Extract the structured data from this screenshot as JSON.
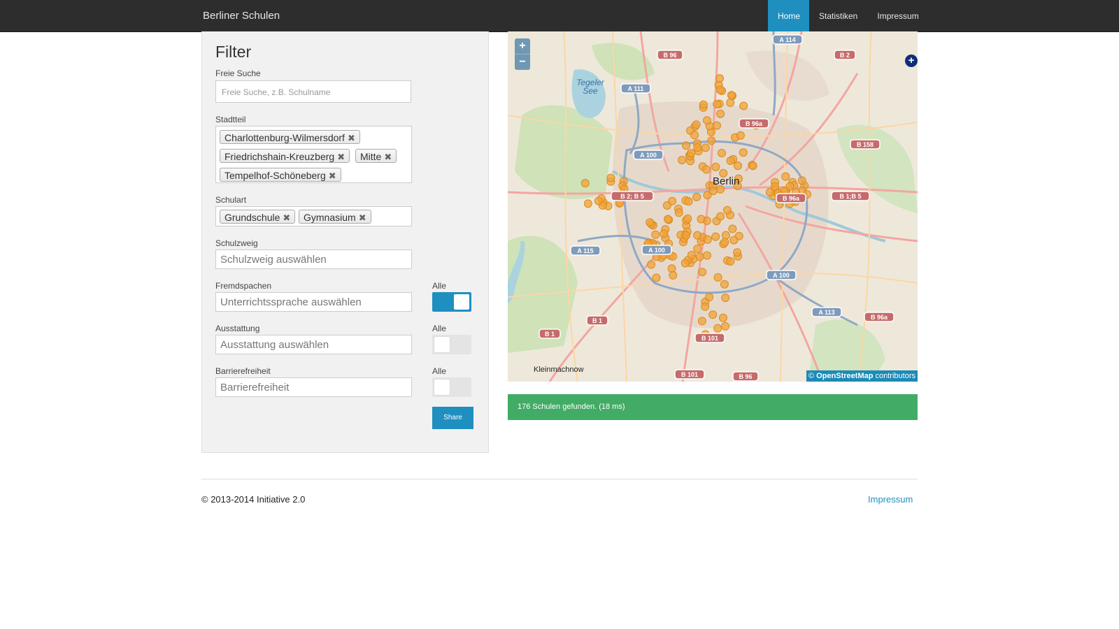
{
  "navbar": {
    "brand": "Berliner Schulen",
    "items": [
      {
        "label": "Home",
        "active": true
      },
      {
        "label": "Statistiken",
        "active": false
      },
      {
        "label": "Impressum",
        "active": false
      }
    ]
  },
  "filter": {
    "title": "Filter",
    "search": {
      "label": "Freie Suche",
      "placeholder": "Freie Suche, z.B. Schulname"
    },
    "district": {
      "label": "Stadtteil",
      "tags": [
        "Charlottenburg-Wilmersdorf",
        "Friedrichshain-Kreuzberg",
        "Mitte",
        "Tempelhof-Schöneberg"
      ]
    },
    "school_type": {
      "label": "Schulart",
      "tags": [
        "Grundschule",
        "Gymnasium"
      ]
    },
    "branch": {
      "label": "Schulzweig",
      "placeholder": "Schulzweig auswählen"
    },
    "languages": {
      "label": "Fremdspachen",
      "placeholder": "Unterrichtssprache auswählen",
      "toggle_label": "Alle",
      "toggle_on": true
    },
    "equipment": {
      "label": "Ausstattung",
      "placeholder": "Ausstattung auswählen",
      "toggle_label": "Alle",
      "toggle_on": false
    },
    "accessibility": {
      "label": "Barrierefreiheit",
      "placeholder": "Barrierefreiheit",
      "toggle_label": "Alle",
      "toggle_on": false
    },
    "share_label": "Share"
  },
  "map": {
    "zoom_in": "+",
    "zoom_out": "−",
    "city_label": "Berlin",
    "place_label": "Kleinmachnow",
    "lake_label": "Tegeler See",
    "attribution_prefix": "©",
    "attribution_link": "OpenStreetMap",
    "attribution_suffix": "contributors",
    "road_shields": [
      "A 114",
      "B 96",
      "B 2",
      "A 111",
      "B 96a",
      "B 158",
      "A 100",
      "B 2; B 5",
      "B 1;B 5",
      "B 96a",
      "A 115",
      "A 100",
      "A 100",
      "A 113",
      "B 96a",
      "B 1",
      "B 1",
      "B 101",
      "B 101",
      "B 96"
    ]
  },
  "status": {
    "text": "176 Schulen gefunden. (18 ms)"
  },
  "footer": {
    "copyright": "© 2013-2014 Initiative 2.0",
    "impressum": "Impressum"
  }
}
